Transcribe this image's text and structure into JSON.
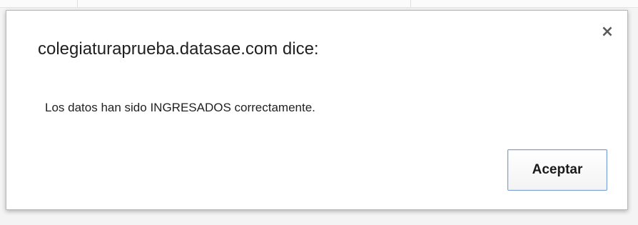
{
  "dialog": {
    "title": "colegiaturaprueba.datasae.com dice:",
    "message": "Los datos han sido INGRESADOS correctamente.",
    "close_icon": "×",
    "ok_button_label": "Aceptar"
  },
  "colors": {
    "button_border": "#7aa0d8",
    "dialog_background": "#ffffff",
    "backdrop": "#f4f4f4"
  },
  "icons": {
    "close": "close-icon"
  }
}
